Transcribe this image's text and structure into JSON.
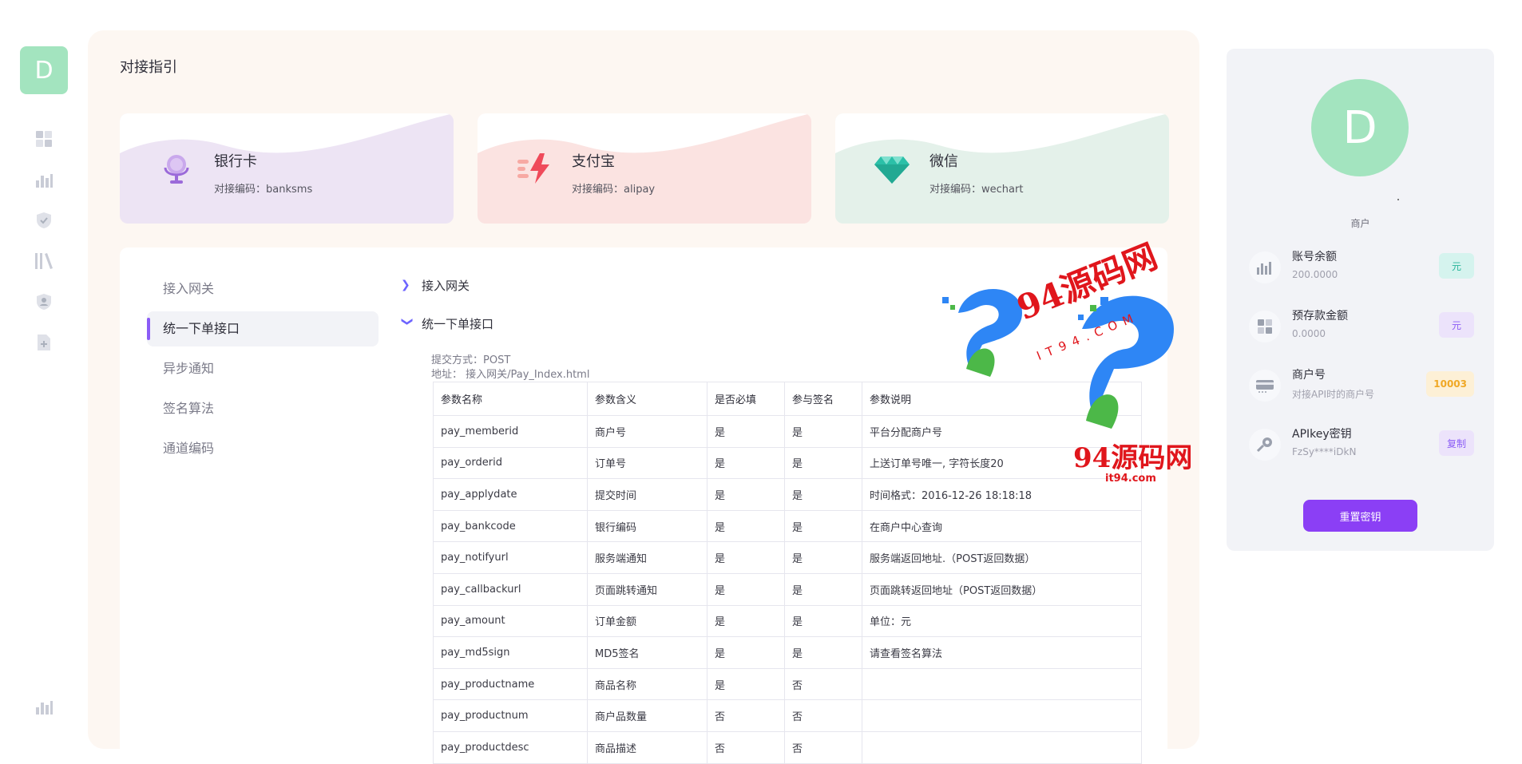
{
  "app": {
    "avatar_letter": "D"
  },
  "nav": {
    "icons": [
      "dashboard-icon",
      "chart-icon",
      "shield-check-icon",
      "library-icon",
      "user-badge-icon",
      "file-add-icon"
    ],
    "bottom_icon": "chart-icon"
  },
  "main": {
    "title": "对接指引",
    "cards": [
      {
        "name": "银行卡",
        "code_label": "对接编码：",
        "code": "banksms",
        "icon": "microphone-icon",
        "color": "#ede4f4"
      },
      {
        "name": "支付宝",
        "code_label": "对接编码：",
        "code": "alipay",
        "icon": "lightning-icon",
        "color": "#fbe3e1"
      },
      {
        "name": "微信",
        "code_label": "对接编码：",
        "code": "wechart",
        "icon": "diamond-icon",
        "color": "#e4f1ea"
      }
    ]
  },
  "doc": {
    "menu": [
      "接入网关",
      "统一下单接口",
      "异步通知",
      "签名算法",
      "通道编码"
    ],
    "active_menu_index": 1,
    "sections": {
      "gateway": "接入网关",
      "unified": "统一下单接口",
      "submit_method": "提交方式：POST",
      "address": "地址：  接入网关/Pay_Index.html"
    },
    "table": {
      "headers": [
        "参数名称",
        "参数含义",
        "是否必填",
        "参与签名",
        "参数说明"
      ],
      "rows": [
        [
          "pay_memberid",
          "商户号",
          "是",
          "是",
          "平台分配商户号"
        ],
        [
          "pay_orderid",
          "订单号",
          "是",
          "是",
          "上送订单号唯一, 字符长度20"
        ],
        [
          "pay_applydate",
          "提交时间",
          "是",
          "是",
          "时间格式：2016-12-26 18:18:18"
        ],
        [
          "pay_bankcode",
          "银行编码",
          "是",
          "是",
          "在商户中心查询"
        ],
        [
          "pay_notifyurl",
          "服务端通知",
          "是",
          "是",
          "服务端返回地址.（POST返回数据）"
        ],
        [
          "pay_callbackurl",
          "页面跳转通知",
          "是",
          "是",
          "页面跳转返回地址（POST返回数据）"
        ],
        [
          "pay_amount",
          "订单金额",
          "是",
          "是",
          "单位：元"
        ],
        [
          "pay_md5sign",
          "MD5签名",
          "是",
          "是",
          "请查看签名算法"
        ],
        [
          "pay_productname",
          "商品名称",
          "是",
          "否",
          ""
        ],
        [
          "pay_productnum",
          "商户品数量",
          "否",
          "否",
          ""
        ],
        [
          "pay_productdesc",
          "商品描述",
          "否",
          "否",
          ""
        ]
      ]
    }
  },
  "profile": {
    "avatar_letter": "D",
    "dot": ".",
    "role": "商户",
    "stats": [
      {
        "label": "账号余额",
        "value": "200.0000",
        "badge": "元",
        "icon": "chart-icon",
        "badge_bg": "#d5f3ee",
        "badge_color": "#27b59b"
      },
      {
        "label": "预存款金额",
        "value": "0.0000",
        "badge": "元",
        "icon": "dashboard-icon",
        "badge_bg": "#ece3fb",
        "badge_color": "#8b5cf6"
      },
      {
        "label": "商户号",
        "value": "对接API时的商户号",
        "badge": "10003",
        "icon": "card-icon",
        "badge_bg": "#fdf0d6",
        "badge_color": "#f0a825"
      },
      {
        "label": "APIkey密钥",
        "value": "FzSy****iDkN",
        "badge": "复制",
        "icon": "key-icon",
        "badge_bg": "#ece3fb",
        "badge_color": "#8b5cf6"
      }
    ],
    "reset_label": "重置密钥"
  },
  "watermark": {
    "top_text": "94源码网",
    "sub_text": "IT94.COM",
    "bottom_text": "94源码网",
    "url": "it94.com"
  }
}
